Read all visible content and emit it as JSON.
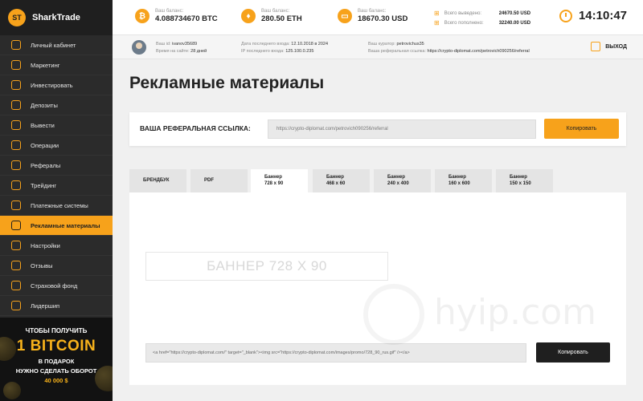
{
  "app": {
    "name": "SharkTrade",
    "logo_text": "ST"
  },
  "header": {
    "balances": [
      {
        "icon": "bitcoin-icon",
        "glyph": "₿",
        "label": "Ваш баланс:",
        "value": "4.088734670 BTC"
      },
      {
        "icon": "ethereum-icon",
        "glyph": "♦",
        "label": "Ваш баланс:",
        "value": "280.50 ETH"
      },
      {
        "icon": "card-icon",
        "glyph": "▭",
        "label": "Ваш баланс:",
        "value": "18670.30 USD"
      }
    ],
    "stats": [
      {
        "label": "Всего выведено:",
        "value": "24670.50 USD"
      },
      {
        "label": "Всего пополнено:",
        "value": "32240.00 USD"
      }
    ],
    "time": "14:10:47"
  },
  "userbar": {
    "login_label": "Ваш id:",
    "login": "ivanov35689",
    "time_label": "Время на сайте:",
    "time": "28 дней",
    "last_visit_label": "Дата последнего входа:",
    "last_visit": "12.10.2018 в 2024",
    "ip_label": "IP последнего входа:",
    "ip": "125.100.0.235",
    "curator_label": "Ваш куратор:",
    "curator": "petrovichus35",
    "ref_label": "Ваша реферальная ссылка:",
    "ref": "https://crypto-diplomat.com/petrovich090256/referral",
    "exit_label": "ВЫХОД"
  },
  "sidebar": {
    "items": [
      {
        "label": "Личный кабинет",
        "icon": "user-icon"
      },
      {
        "label": "Маркетинг",
        "icon": "megaphone-icon"
      },
      {
        "label": "Инвестировать",
        "icon": "invest-icon"
      },
      {
        "label": "Депозиты",
        "icon": "deposit-icon"
      },
      {
        "label": "Вывести",
        "icon": "withdraw-icon"
      },
      {
        "label": "Операции",
        "icon": "operations-icon"
      },
      {
        "label": "Рефералы",
        "icon": "referrals-icon"
      },
      {
        "label": "Трейдинг",
        "icon": "trading-icon"
      },
      {
        "label": "Платежные системы",
        "icon": "payment-icon"
      },
      {
        "label": "Рекламные материалы",
        "icon": "promo-icon",
        "active": true
      },
      {
        "label": "Настройки",
        "icon": "settings-icon"
      },
      {
        "label": "Отзывы",
        "icon": "reviews-icon"
      },
      {
        "label": "Страховой фонд",
        "icon": "insurance-icon"
      },
      {
        "label": "Лидершип",
        "icon": "leadership-icon"
      }
    ],
    "promo": {
      "line1": "ЧТОБЫ ПОЛУЧИТЬ",
      "big": "1 BITCOIN",
      "line2": "В ПОДАРОК",
      "line3": "НУЖНО СДЕЛАТЬ ОБОРОТ",
      "amount": "40 000 $"
    }
  },
  "main": {
    "title": "Рекламные материалы",
    "ref_link_label": "ВАША РЕФЕРАЛЬНАЯ ССЫЛКА:",
    "ref_link_value": "https://crypto-diplomat.com/petrovich090256/referral",
    "copy_label": "Копировать",
    "tabs": [
      {
        "line1": "БРЕНДБУК",
        "line2": ""
      },
      {
        "line1": "PDF",
        "line2": ""
      },
      {
        "line1": "Баннер",
        "line2": "728 x 90",
        "active": true
      },
      {
        "line1": "Баннер",
        "line2": "468 x 60"
      },
      {
        "line1": "Баннер",
        "line2": "240 x 400"
      },
      {
        "line1": "Баннер",
        "line2": "160 x 600"
      },
      {
        "line1": "Баннер",
        "line2": "150 x 150"
      }
    ],
    "banner_placeholder": "БАННЕР 728 X 90",
    "banner_code": "<a href=\"https://crypto-diplomat.com/\" target=\"_blank\"><img src=\"https://crypto-diplomat.com/images/promo/728_90_rus.gif\" /></a>",
    "copy2_label": "Копировать"
  },
  "watermark": "hyip.com",
  "colors": {
    "accent": "#f7a21b",
    "sidebar": "#2b2b2b",
    "dark_button": "#1f1f1f"
  }
}
